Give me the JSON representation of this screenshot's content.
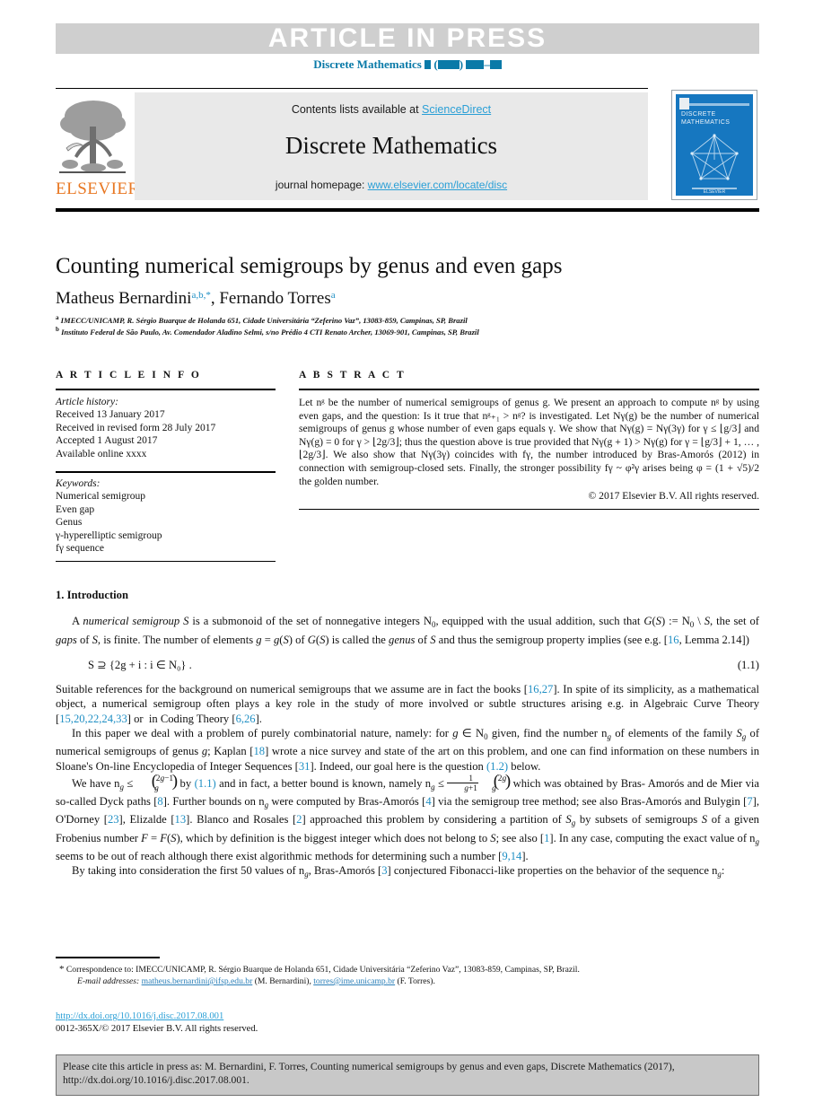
{
  "banner": {
    "article_in_press": "ARTICLE  IN  PRESS",
    "journal_ref_prefix": "Discrete Mathematics",
    "journal_ref_blocks": "■ (■■■) ■■–■■"
  },
  "masthead": {
    "contents_prefix": "Contents lists available at ",
    "contents_link": "ScienceDirect",
    "journal_title": "Discrete Mathematics",
    "homepage_prefix": "journal homepage: ",
    "homepage_link": "www.elsevier.com/locate/disc",
    "publisher_logo_text": "ELSEVIER",
    "cover_title": "DISCRETE MATHEMATICS",
    "cover_footer": "ELSEVIER"
  },
  "article": {
    "title": "Counting numerical semigroups by genus and even gaps",
    "authors": [
      {
        "name": "Matheus Bernardini",
        "marks": "a,b,*"
      },
      {
        "name": "Fernando Torres",
        "marks": "a"
      }
    ],
    "affiliations": [
      {
        "marker": "a",
        "text": "IMECC/UNICAMP, R. Sérgio Buarque de Holanda 651, Cidade Universitária “Zeferino Vaz”, 13083-859, Campinas, SP, Brazil"
      },
      {
        "marker": "b",
        "text": "Instituto Federal de São Paulo, Av. Comendador Aladino Selmi, s/no Prédio 4 CTI Renato Archer, 13069-901, Campinas, SP, Brazil"
      }
    ]
  },
  "info": {
    "heading": "A R T I C L E   I N F O",
    "history_label": "Article history:",
    "history": [
      "Received 13 January 2017",
      "Received in revised form 28 July 2017",
      "Accepted 1 August 2017",
      "Available online xxxx"
    ],
    "keywords_label": "Keywords:",
    "keywords": [
      "Numerical semigroup",
      "Even gap",
      "Genus",
      "γ-hyperelliptic semigroup",
      "fγ sequence"
    ]
  },
  "abstract": {
    "heading": "A B S T R A C T",
    "body": "Let nᵍ be the number of numerical semigroups of genus g. We present an approach to compute nᵍ by using even gaps, and the question: Is it true that nᵍ₊₁ > nᵍ? is investigated. Let Nγ(g) be the number of numerical semigroups of genus g whose number of even gaps equals γ. We show that Nγ(g) = Nγ(3γ) for γ ≤ ⌊g/3⌋ and Nγ(g) = 0 for γ > ⌊2g/3⌋; thus the question above is true provided that Nγ(g + 1) > Nγ(g) for γ = ⌊g/3⌋ + 1, … , ⌊2g/3⌋. We also show that Nγ(3γ) coincides with fγ, the number introduced by Bras-Amorós (2012) in connection with semigroup-closed sets. Finally, the stronger possibility fγ ~ φ²γ arises being φ = (1 + √5)/2 the golden number.",
    "copyright": "© 2017 Elsevier B.V. All rights reserved."
  },
  "intro": {
    "heading": "1.  Introduction",
    "para1_a": "A numerical semigroup",
    "para1_b": "S is a submonoid of the set of nonnegative integers N",
    "equation": "S ⊇ {2g + i : i ∈ N₀} .",
    "equation_number": "(1.1)",
    "refs": {
      "r16": "16",
      "r16_27": "16,27",
      "r15list": "15,20,22,24,33",
      "r6_26": "6,26",
      "r18": "18",
      "r31": "31",
      "r12": "(1.2)",
      "r11": "(1.1)",
      "r8": "8",
      "r4": "4",
      "r7": "7",
      "r23": "23",
      "r13": "13",
      "r2": "2",
      "r1": "1",
      "r9_14": "9,14",
      "r3": "3"
    }
  },
  "footnote": {
    "correspondence": "Correspondence to: IMECC/UNICAMP, R. Sérgio Buarque de Holanda 651, Cidade Universitária “Zeferino Vaz”, 13083-859, Campinas, SP, Brazil.",
    "email_label": "E-mail addresses:",
    "email1": "matheus.bernardini@ifsp.edu.br",
    "email1_owner": "(M. Bernardini)",
    "email2": "torres@ime.unicamp.br",
    "email2_owner": "(F. Torres)."
  },
  "doi": {
    "url": "http://dx.doi.org/10.1016/j.disc.2017.08.001",
    "issn_line": "0012-365X/© 2017 Elsevier B.V. All rights reserved."
  },
  "cite_box": {
    "line1": "Please cite this article in press as: M. Bernardini, F. Torres, Counting numerical semigroups by genus and even gaps, Discrete Mathematics (2017),",
    "line2": "http://dx.doi.org/10.1016/j.disc.2017.08.001."
  },
  "colors": {
    "link_blue": "#2a9fd6",
    "ref_blue": "#1f8fc4",
    "journal_blue": "#0a7aa8",
    "elsevier_orange": "#e87722",
    "banner_grey": "#cfcfcf",
    "panel_grey": "#e9e9e9",
    "cite_grey": "#c8c8c8"
  }
}
